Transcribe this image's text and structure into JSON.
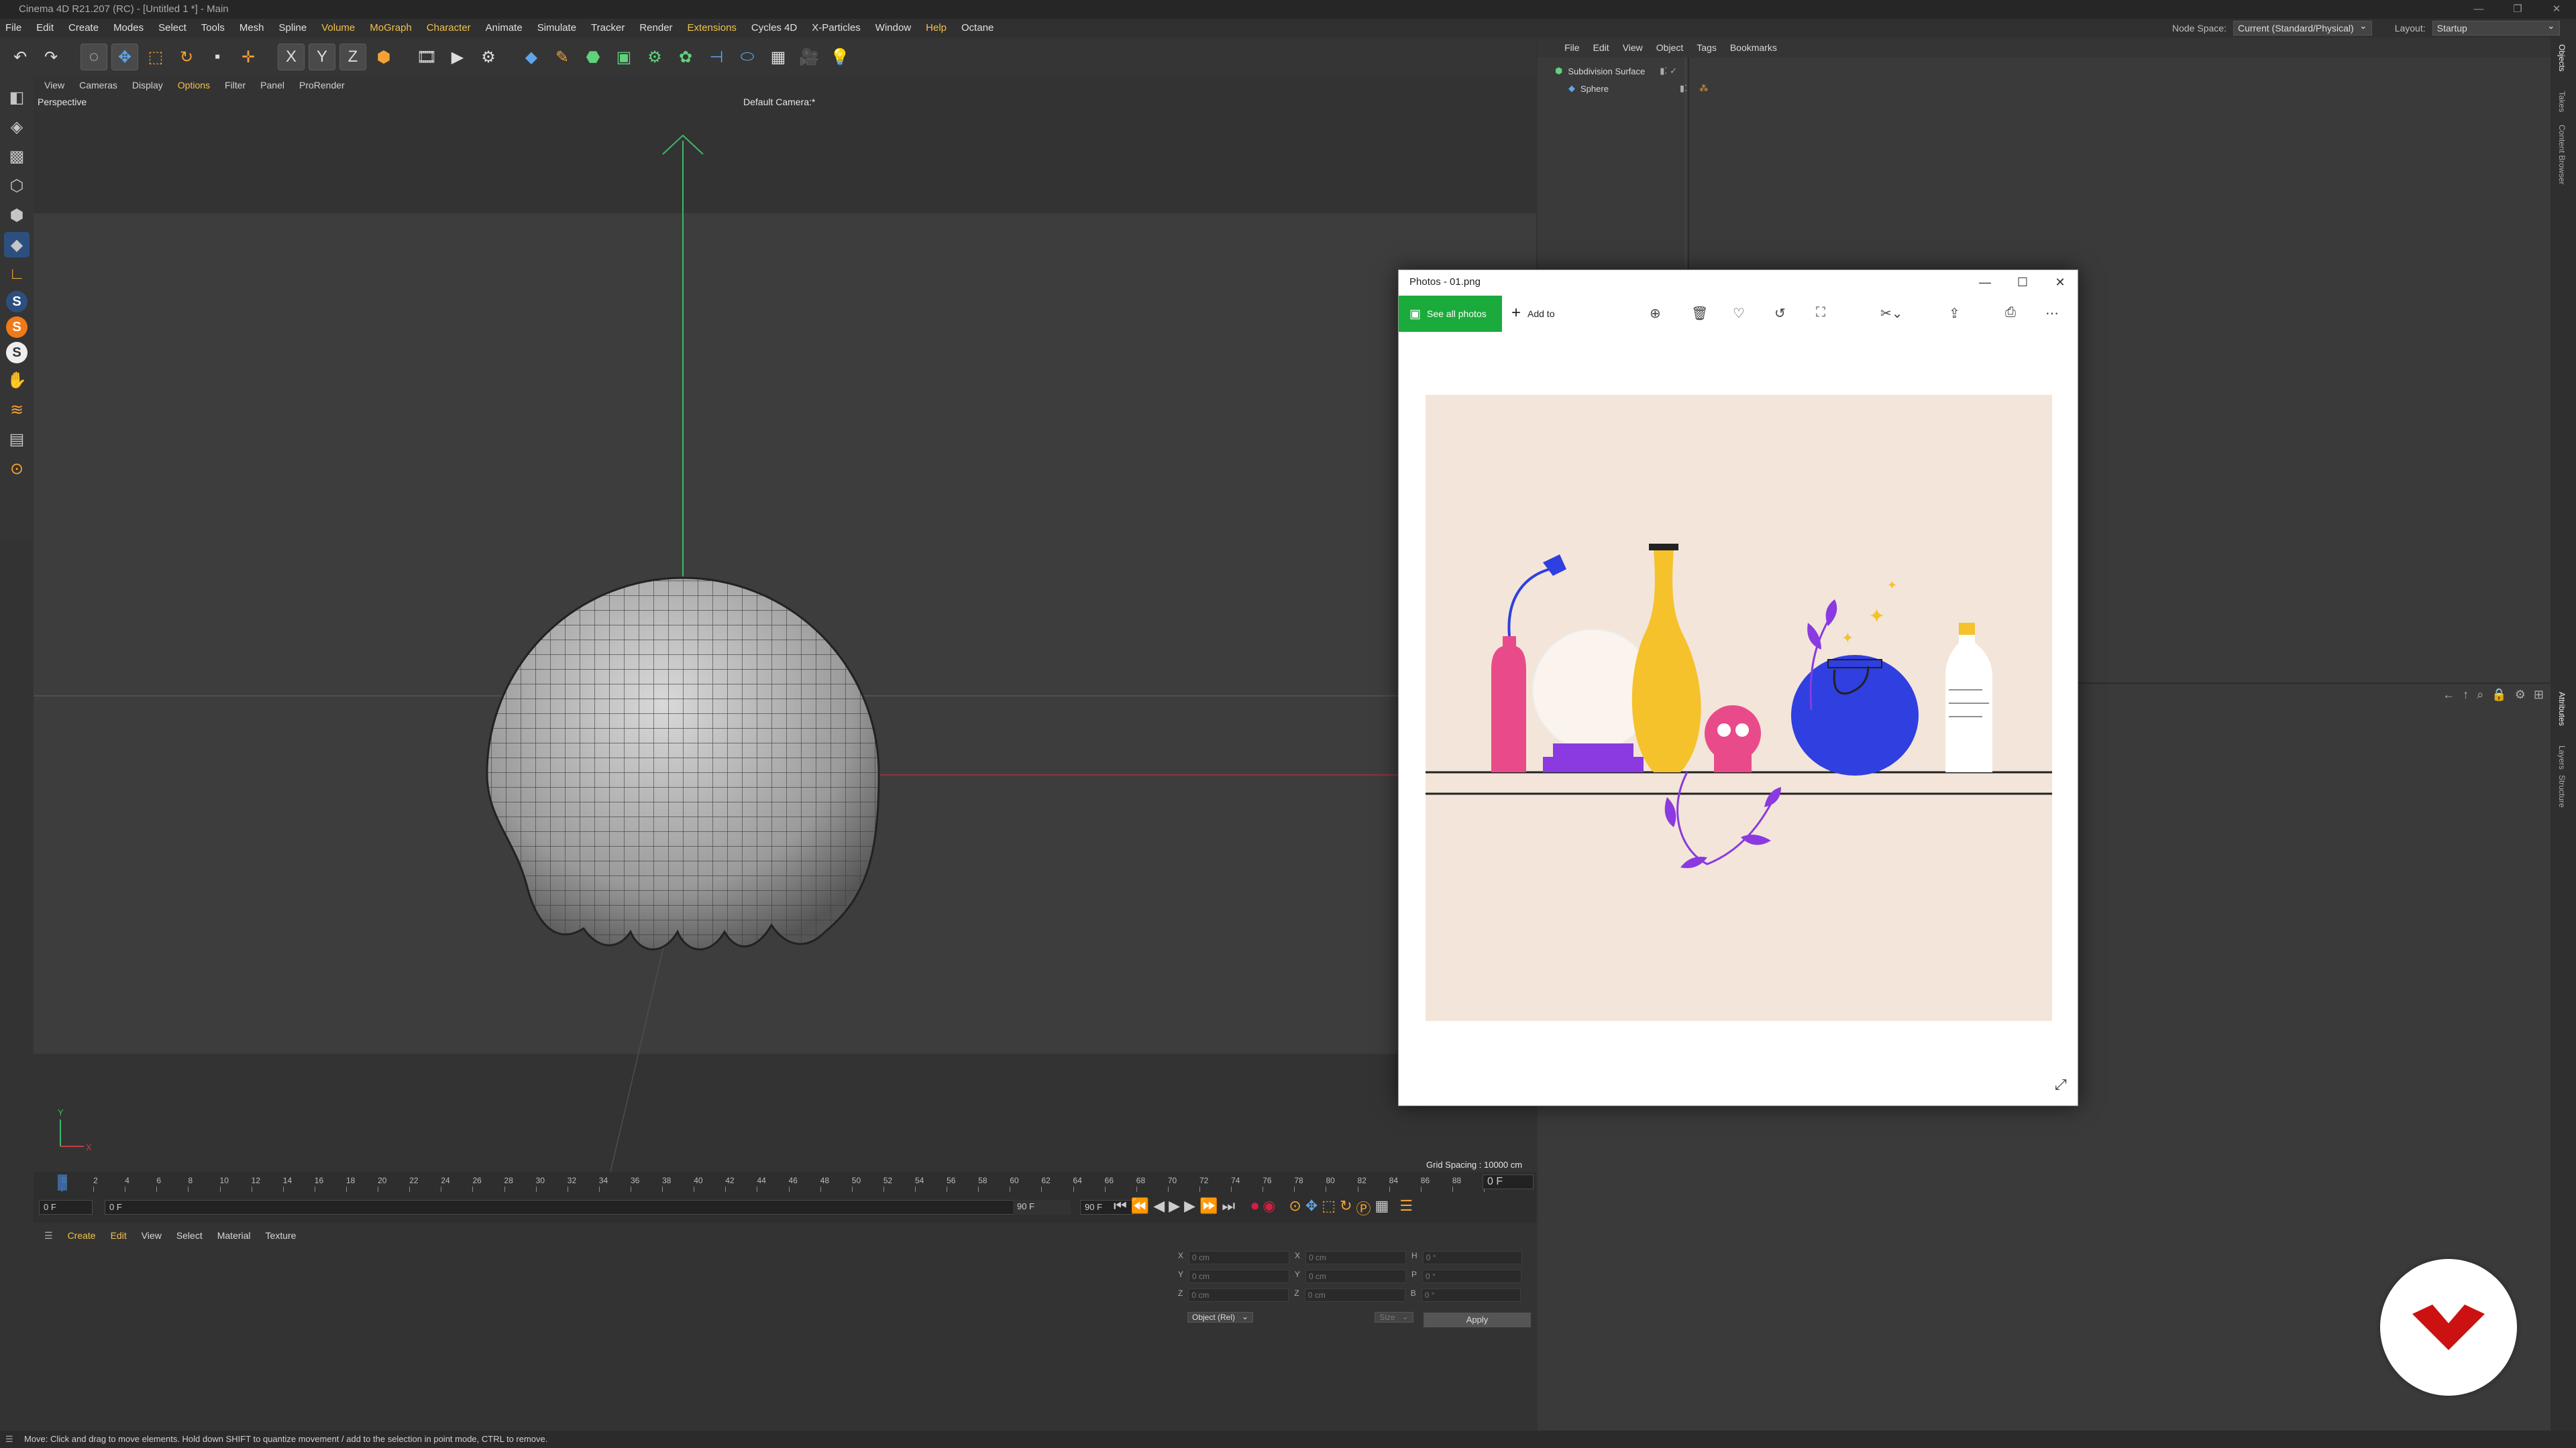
{
  "window": {
    "title": "Cinema 4D R21.207 (RC) - [Untitled 1 *] - Main",
    "controls": [
      "—",
      "❐",
      "✕"
    ]
  },
  "menubar": {
    "items": [
      "File",
      "Edit",
      "Create",
      "Modes",
      "Select",
      "Tools",
      "Mesh",
      "Spline",
      "Volume",
      "MoGraph",
      "Character",
      "Animate",
      "Simulate",
      "Tracker",
      "Render",
      "Extensions",
      "Cycles 4D",
      "X-Particles",
      "Window",
      "Help",
      "Octane"
    ],
    "node_space_label": "Node Space:",
    "node_space_value": "Current (Standard/Physical)",
    "layout_label": "Layout:",
    "layout_value": "Startup"
  },
  "toolbar": {
    "icons": [
      "undo-icon",
      "redo-icon",
      "live-selection-icon",
      "move-icon",
      "scale-icon",
      "rotate-icon",
      "recent-tools-icon",
      "transform-icon",
      "x-axis-icon",
      "y-axis-icon",
      "z-axis-icon",
      "coordinate-system-icon",
      "render-view-icon",
      "render-picture-viewer-icon",
      "render-settings-icon",
      "cube-icon",
      "pen-icon",
      "subdivision-icon",
      "array-icon",
      "deformer-icon",
      "field-icon",
      "scene-icon",
      "camera-icon",
      "light-icon"
    ],
    "axis_labels": [
      "X",
      "Y",
      "Z"
    ]
  },
  "viewport": {
    "menu": [
      "View",
      "Cameras",
      "Display",
      "Options",
      "Filter",
      "Panel",
      "ProRender"
    ],
    "label": "Perspective",
    "camera": "Default Camera:*",
    "grid_spacing": "Grid Spacing : 10000 cm",
    "axis_y": "Y",
    "axis_x": "X"
  },
  "timeline": {
    "ticks": [
      "0",
      "2",
      "4",
      "6",
      "8",
      "10",
      "12",
      "14",
      "16",
      "18",
      "20",
      "22",
      "24",
      "26",
      "28",
      "30",
      "32",
      "34",
      "36",
      "38",
      "40",
      "42",
      "44",
      "46",
      "48",
      "50",
      "52",
      "54",
      "56",
      "58",
      "60",
      "62",
      "64",
      "66",
      "68",
      "70",
      "72",
      "74",
      "76",
      "78",
      "80",
      "82",
      "84",
      "86",
      "88",
      "90"
    ],
    "current_frame": "0 F",
    "start": "0 F",
    "range_start": "0 F",
    "range_end": "90 F",
    "end": "90 F",
    "max": "90 F"
  },
  "material": {
    "menu": [
      "Create",
      "Edit",
      "View",
      "Select",
      "Material",
      "Texture"
    ]
  },
  "coords": {
    "rows": [
      {
        "a": "X",
        "av": "0 cm",
        "b": "X",
        "bv": "0 cm",
        "c": "H",
        "cv": "0 °"
      },
      {
        "a": "Y",
        "av": "0 cm",
        "b": "Y",
        "bv": "0 cm",
        "c": "P",
        "cv": "0 °"
      },
      {
        "a": "Z",
        "av": "0 cm",
        "b": "Z",
        "bv": "0 cm",
        "c": "B",
        "cv": "0 °"
      }
    ],
    "mode": "Object (Rel)",
    "size": "Size",
    "apply": "Apply"
  },
  "objects": {
    "menu": [
      "File",
      "Edit",
      "View",
      "Object",
      "Tags",
      "Bookmarks"
    ],
    "items": [
      {
        "name": "Subdivision Surface"
      },
      {
        "name": "Sphere"
      }
    ]
  },
  "right_tabs": {
    "top": [
      "Objects",
      "Takes",
      "Content Browser"
    ],
    "bottom": [
      "Attributes",
      "Layers",
      "Structure"
    ]
  },
  "status": {
    "text": "Move: Click and drag to move elements. Hold down SHIFT to quantize movement / add to the selection in point mode, CTRL to remove."
  },
  "photos": {
    "title": "Photos - 01.png",
    "see_all": "See all photos",
    "add_to": "Add to",
    "controls": [
      "—",
      "☐",
      "✕"
    ],
    "tools": [
      "zoom-icon",
      "delete-icon",
      "favorite-icon",
      "rotate-icon",
      "crop-icon",
      "edit-icon",
      "share-icon",
      "print-icon",
      "more-icon"
    ]
  },
  "colors": {
    "accent": "#f0c24a",
    "photos_green": "#1aab3c",
    "badge_red": "#cc1111",
    "pink": "#e94b8a",
    "yellow": "#f5c22b",
    "blue": "#2f3fe0",
    "purple": "#8a3ae0",
    "cream": "#f3e5d9"
  }
}
